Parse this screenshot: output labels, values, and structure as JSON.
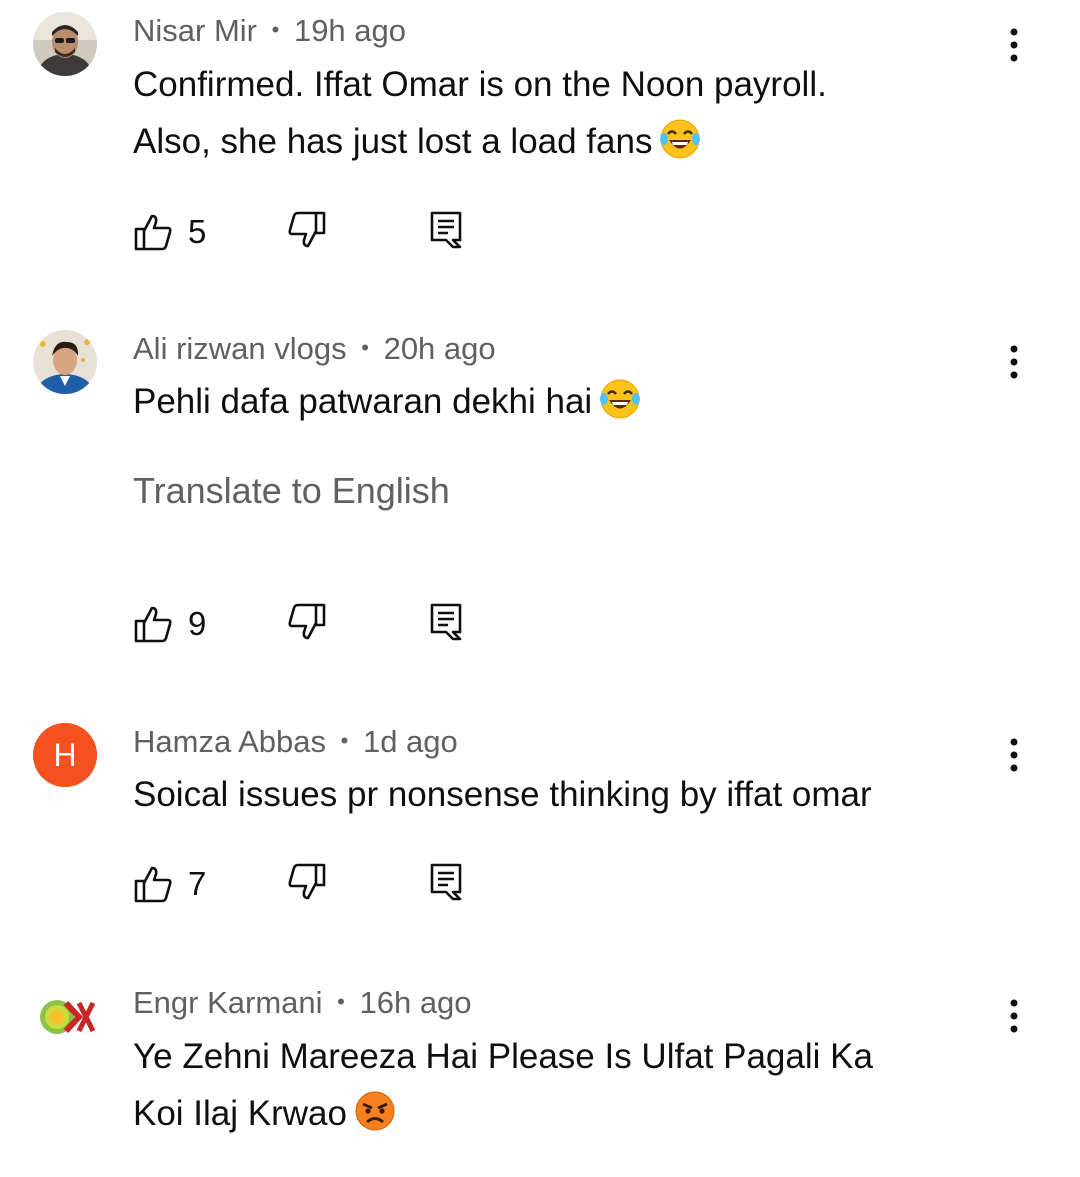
{
  "comments": [
    {
      "author": "Nisar Mir",
      "separator": "•",
      "time": "19h ago",
      "text_lines": [
        "Confirmed. Iffat Omar is on the Noon payroll.",
        "Also, she has just lost a load fans"
      ],
      "emoji": "laughing-tears",
      "likes": "5",
      "avatar_type": "photo"
    },
    {
      "author": "Ali rizwan vlogs",
      "separator": "•",
      "time": "20h ago",
      "text_lines": [
        "Pehli dafa patwaran dekhi hai"
      ],
      "emoji": "laughing-tears",
      "translate_label": "Translate to English",
      "likes": "9",
      "avatar_type": "photo"
    },
    {
      "author": "Hamza Abbas",
      "separator": "•",
      "time": "1d ago",
      "text_lines": [
        "Soical issues pr nonsense thinking by iffat omar"
      ],
      "likes": "7",
      "avatar_letter": "H",
      "avatar_color": "#f4511e"
    },
    {
      "author": "Engr Karmani",
      "separator": "•",
      "time": "16h ago",
      "text_lines": [
        "Ye Zehni Mareeza Hai Please Is Ulfat Pagali Ka",
        "Koi Ilaj Krwao"
      ],
      "emoji": "angry-face",
      "avatar_type": "logo"
    }
  ],
  "icons": {
    "like": "thumbs-up-icon",
    "dislike": "thumbs-down-icon",
    "reply": "reply-icon",
    "menu": "more-vert-icon"
  }
}
